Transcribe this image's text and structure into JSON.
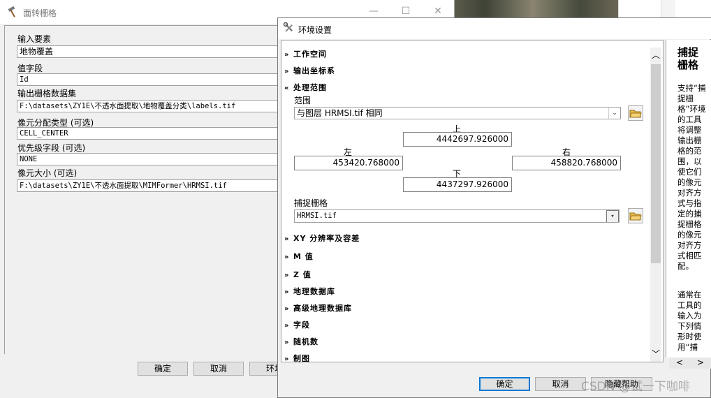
{
  "background_window": {
    "title": "面转栅格",
    "fields": [
      {
        "label": "输入要素",
        "value": "地物覆盖"
      },
      {
        "label": "值字段",
        "value": "Id"
      },
      {
        "label": "输出栅格数据集",
        "value": "F:\\datasets\\ZY1E\\不透水面提取\\地物覆盖分类\\labels.tif"
      },
      {
        "label": "像元分配类型 (可选)",
        "value": "CELL_CENTER"
      },
      {
        "label": "优先级字段 (可选)",
        "value": "NONE"
      },
      {
        "label": "像元大小 (可选)",
        "value": "F:\\datasets\\ZY1E\\不透水面提取\\MIMFormer\\HRMSI.tif"
      }
    ],
    "buttons": {
      "ok": "确定",
      "cancel": "取消",
      "env": "环境"
    }
  },
  "env_window": {
    "title": "环境设置",
    "sections": {
      "workspace": "工作空间",
      "output_coords": "输出坐标系",
      "processing_extent": "处理范围",
      "xy": "XY 分辨率及容差",
      "m": "M 值",
      "z": "Z 值",
      "geodatabase": "地理数据库",
      "adv_geodatabase": "高级地理数据库",
      "fields": "字段",
      "random": "随机数",
      "cartography": "制图"
    },
    "extent": {
      "label": "范围",
      "value": "与图层 HRMSI.tif 相同",
      "top_label": "上",
      "top": "4442697.926000",
      "left_label": "左",
      "left": "453420.768000",
      "right_label": "右",
      "right": "458820.768000",
      "bottom_label": "下",
      "bottom": "4437297.926000"
    },
    "snap": {
      "label": "捕捉栅格",
      "value": "HRMSI.tif"
    },
    "help": {
      "title": "捕捉栅格",
      "text": "支持“捕捉栅格”环境的工具将调整输出栅格的范围，以使它们的像元对齐方式与指定的捕捉栅格的像元对齐方式相匹配。",
      "text2": "通常在工具的输入为下列情形时使用“捕"
    },
    "buttons": {
      "ok": "确定",
      "cancel": "取消",
      "help": "隐藏帮助"
    }
  },
  "watermark": "CSDN @试一下咖啡"
}
